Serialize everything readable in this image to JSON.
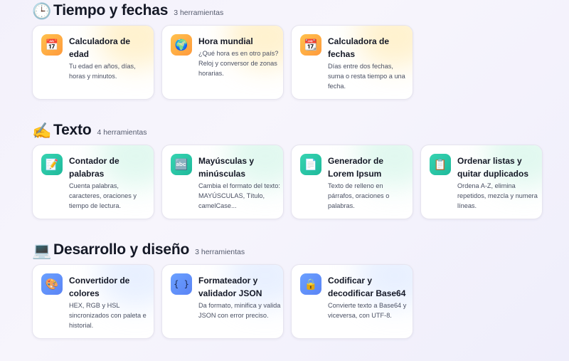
{
  "sections": [
    {
      "emoji": "🕒",
      "title": "Tiempo y fechas",
      "count": "3 herramientas",
      "cards": [
        {
          "icon": "calendar-icon",
          "glyph": "📅",
          "title": "Calculadora de edad",
          "desc": "Tu edad en años, días, horas y minutos."
        },
        {
          "icon": "globe-icon",
          "glyph": "🌍",
          "title": "Hora mundial",
          "desc": "¿Qué hora es en otro país? Reloj y conversor de zonas horarias."
        },
        {
          "icon": "calendar-grid-icon",
          "glyph": "📆",
          "title": "Calculadora de fechas",
          "desc": "Días entre dos fechas, suma o resta tiempo a una fecha."
        }
      ]
    },
    {
      "emoji": "✍️",
      "title": "Texto",
      "count": "4 herramientas",
      "cards": [
        {
          "icon": "document-pencil-icon",
          "glyph": "📝",
          "title": "Contador de palabras",
          "desc": "Cuenta palabras, caracteres, oraciones y tiempo de lectura."
        },
        {
          "icon": "abcd-icon",
          "glyph": "🔤",
          "title": "Mayúsculas y minúsculas",
          "desc": "Cambia el formato del texto: MAYÚSCULAS, Título, camelCase..."
        },
        {
          "icon": "page-icon",
          "glyph": "📄",
          "title": "Generador de Lorem Ipsum",
          "desc": "Texto de relleno en párrafos, oraciones o palabras."
        },
        {
          "icon": "clipboard-icon",
          "glyph": "📋",
          "title": "Ordenar listas y quitar duplicados",
          "desc": "Ordena A-Z, elimina repetidos, mezcla y numera líneas."
        }
      ]
    },
    {
      "emoji": "💻",
      "title": "Desarrollo y diseño",
      "count": "3 herramientas",
      "cards": [
        {
          "icon": "palette-icon",
          "glyph": "🎨",
          "title": "Convertidor de colores",
          "desc": "HEX, RGB y HSL sincronizados con paleta e historial."
        },
        {
          "icon": "braces-icon",
          "glyph": "{ }",
          "title": "Formateador y validador JSON",
          "desc": "Da formato, minifica y valida JSON con error preciso."
        },
        {
          "icon": "lock-icon",
          "glyph": "🔒",
          "title": "Codificar y decodificar Base64",
          "desc": "Convierte texto a Base64 y viceversa, con UTF-8."
        }
      ]
    }
  ]
}
